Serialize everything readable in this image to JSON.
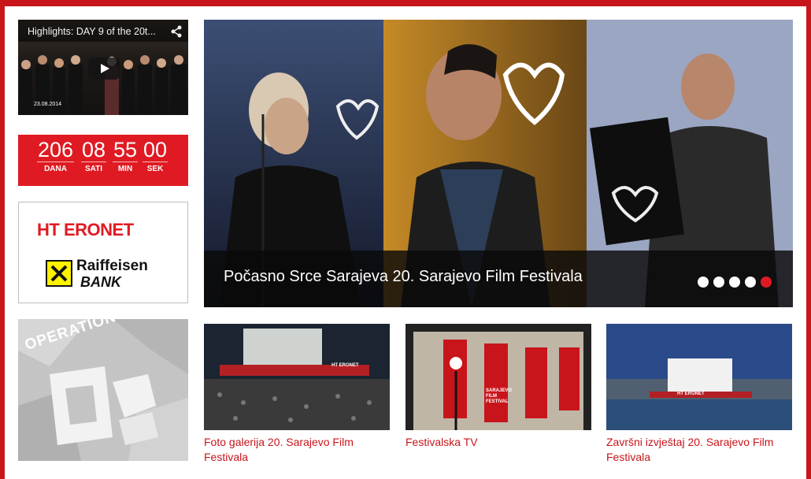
{
  "video": {
    "title": "Highlights: DAY 9 of the 20t...",
    "date": "23.08.2014",
    "share_icon": "share-icon",
    "play_icon": "play-icon"
  },
  "countdown": {
    "units": [
      {
        "value": "206",
        "label": "DANA"
      },
      {
        "value": "08",
        "label": "SATI"
      },
      {
        "value": "55",
        "label": "MIN"
      },
      {
        "value": "00",
        "label": "SEK"
      }
    ]
  },
  "sponsors": {
    "ht_eronet": "HT ERONET",
    "raiffeisen_line1": "Raiffeisen",
    "raiffeisen_line2": "BANK"
  },
  "operation_kino": {
    "text": "OPERATION KINO"
  },
  "slider": {
    "caption": "Počasno Srce Sarajeva 20. Sarajevo Film Festivala",
    "slides_count": 5,
    "active_slide": 5
  },
  "thumbnails": [
    {
      "caption": "Foto galerija 20. Sarajevo Film Festivala",
      "screen_text": "HT ERONET"
    },
    {
      "caption": "Festivalska TV",
      "banner_text": "SARAJEVO FILM FESTIVAL"
    },
    {
      "caption": "Završni izvještaj 20. Sarajevo Film Festivala",
      "screen_text": "HT ERONET"
    }
  ],
  "colors": {
    "brand_red": "#e01a22",
    "link_red": "#c8151b"
  }
}
